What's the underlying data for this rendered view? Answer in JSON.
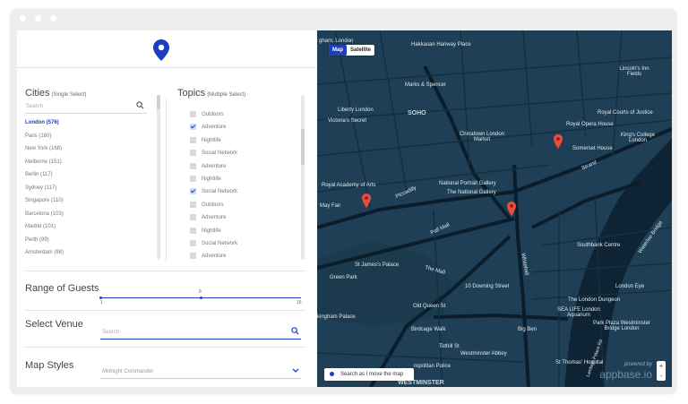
{
  "cities": {
    "title": "Cities",
    "subtitle": "(Single Select)",
    "search_placeholder": "Search",
    "items": [
      {
        "label": "London (576)",
        "active": true
      },
      {
        "label": "Paris (180)"
      },
      {
        "label": "New York (168)"
      },
      {
        "label": "Melborne (151)"
      },
      {
        "label": "Berlin (117)"
      },
      {
        "label": "Sydney (117)"
      },
      {
        "label": "Singapore (110)"
      },
      {
        "label": "Barcelona (103)"
      },
      {
        "label": "Madrid (101)"
      },
      {
        "label": "Perth (99)"
      },
      {
        "label": "Amsterdam (98)"
      }
    ]
  },
  "topics": {
    "title": "Topics",
    "subtitle": "(Multiple Select)",
    "items": [
      {
        "label": "Outdoors",
        "checked": false
      },
      {
        "label": "Adventure",
        "checked": true
      },
      {
        "label": "Nightlife",
        "checked": false
      },
      {
        "label": "Social Network",
        "checked": false
      },
      {
        "label": "Adventure",
        "checked": false
      },
      {
        "label": "Nightlife",
        "checked": false
      },
      {
        "label": "Social Network",
        "checked": true
      },
      {
        "label": "Outdoors",
        "checked": false
      },
      {
        "label": "Adventure",
        "checked": false
      },
      {
        "label": "Nightlife",
        "checked": false
      },
      {
        "label": "Social Network",
        "checked": false
      },
      {
        "label": "Adventure",
        "checked": false
      }
    ]
  },
  "guests": {
    "label": "Range of Guests",
    "min_label": "1",
    "max_label": "15",
    "value_label": "8",
    "value": 8,
    "min": 1,
    "max": 15
  },
  "venue": {
    "label": "Select Venue",
    "placeholder": "Search"
  },
  "map_styles": {
    "label": "Map Styles",
    "selected": "Midnight Commander"
  },
  "map": {
    "type_map": "Map",
    "type_satellite": "Satellite",
    "search_as_move": "Search as I move the map",
    "powered_by": "powered by",
    "brand": "appbase.io",
    "zoom_in": "+",
    "zoom_out": "-",
    "labels": {
      "l1": "gham, London",
      "l2": "Hakkasan Hanway Place",
      "l3": "Lincoln's Inn Fields",
      "l4": "Marks & Spencer",
      "l5": "Liberty London",
      "l6": "SOHO",
      "l7": "Victoria's Secret",
      "l8": "Chinatown London Market",
      "l9": "Royal Opera House",
      "l10": "Royal Courts of Justice",
      "l11": "King's College London",
      "l12": "Somerset House",
      "l13": "Royal Academy of Arts",
      "l14": "National Portrait Gallery",
      "l15": "The National Gallery",
      "l16": "May Fair",
      "l17": "Southbank Centre",
      "l18": "St James's Palace",
      "l19": "Green Park",
      "l20": "10 Downing Street",
      "l21": "London Eye",
      "l22": "The London Dungeon",
      "l23": "SEA LIFE London Aquarium",
      "l24": "Park Plaza Westminster Bridge London",
      "l25": "kingham Palace",
      "l26": "Big Ben",
      "l27": "Westminster Abbey",
      "l28": "St Thomas' Hospital",
      "l29": "WESTMINSTER",
      "l30": "Tothill St",
      "l31": "ropolitan Police",
      "l32": "Pall Mall",
      "l33": "The Mall",
      "l34": "Whitehall",
      "l35": "Strand",
      "l36": "Piccadilly",
      "l37": "Birdcage Walk",
      "l38": "Old Queen St",
      "l39": "Waterloo Bridge",
      "l40": "Lambeth Palace Rd"
    }
  },
  "colors": {
    "accent": "#1a3fc2",
    "map_bg": "#1e3f55",
    "pin": "#e74c3c"
  }
}
